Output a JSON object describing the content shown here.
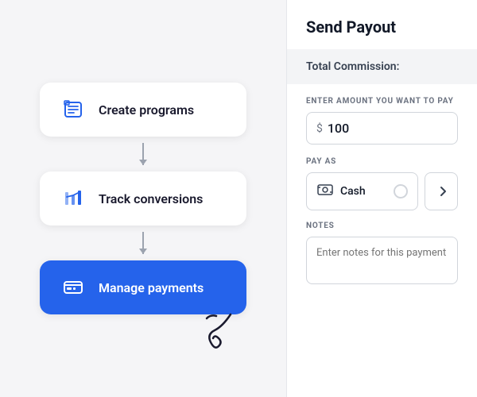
{
  "left": {
    "steps": [
      {
        "id": "create-programs",
        "label": "Create programs",
        "active": false,
        "icon": "programs"
      },
      {
        "id": "track-conversions",
        "label": "Track conversions",
        "active": false,
        "icon": "track"
      },
      {
        "id": "manage-payments",
        "label": "Manage payments",
        "active": true,
        "icon": "payments"
      }
    ]
  },
  "right": {
    "title": "Send Payout",
    "total_commission_label": "Total Commission:",
    "amount_label": "ENTER AMOUNT YOU WANT TO PAY",
    "currency_symbol": "$",
    "amount_value": "100",
    "pay_as_label": "PAY AS",
    "pay_options": [
      {
        "id": "cash",
        "label": "Cash"
      },
      {
        "id": "other",
        "label": "..."
      }
    ],
    "notes_label": "NOTES",
    "notes_placeholder": "Enter notes for this payment"
  }
}
